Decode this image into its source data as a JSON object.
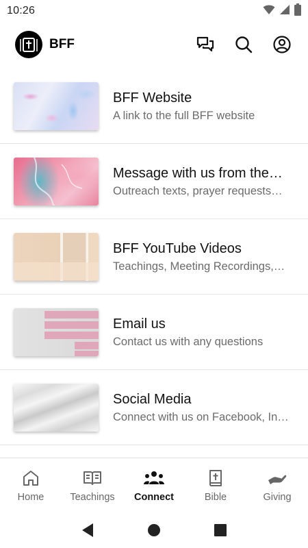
{
  "status_bar": {
    "time": "10:26",
    "icons": [
      "wifi-icon",
      "signal-icon",
      "battery-icon"
    ]
  },
  "app_bar": {
    "title": "BFF",
    "logo": "church-logo",
    "actions": [
      "chat-icon",
      "search-icon",
      "account-icon"
    ]
  },
  "items": [
    {
      "title": "BFF Website",
      "subtitle": "A link to the full BFF website",
      "thumb": "pastel-marble-blue"
    },
    {
      "title": "Message with us from the…",
      "subtitle": "Outreach texts, prayer requests…",
      "thumb": "pink-teal-fluid-art"
    },
    {
      "title": "BFF YouTube Videos",
      "subtitle": "Teachings, Meeting Recordings,…",
      "thumb": "beige-paper-stripes"
    },
    {
      "title": "Email us",
      "subtitle": "Contact us with any questions",
      "thumb": "grey-pink-stripes"
    },
    {
      "title": "Social Media",
      "subtitle": "Connect with us on Facebook, In…",
      "thumb": "white-marble"
    }
  ],
  "bottom_nav": {
    "items": [
      {
        "label": "Home",
        "icon": "home-icon",
        "active": false
      },
      {
        "label": "Teachings",
        "icon": "book-icon",
        "active": false
      },
      {
        "label": "Connect",
        "icon": "group-icon",
        "active": true
      },
      {
        "label": "Bible",
        "icon": "bible-icon",
        "active": false
      },
      {
        "label": "Giving",
        "icon": "giving-hand-icon",
        "active": false
      }
    ]
  },
  "system_nav": [
    "back-icon",
    "home-circle-icon",
    "recents-icon"
  ],
  "colors": {
    "active_nav": "#111111",
    "inactive_nav": "#666666",
    "subtitle": "#6b6b6b",
    "divider": "#e6e6e6"
  }
}
